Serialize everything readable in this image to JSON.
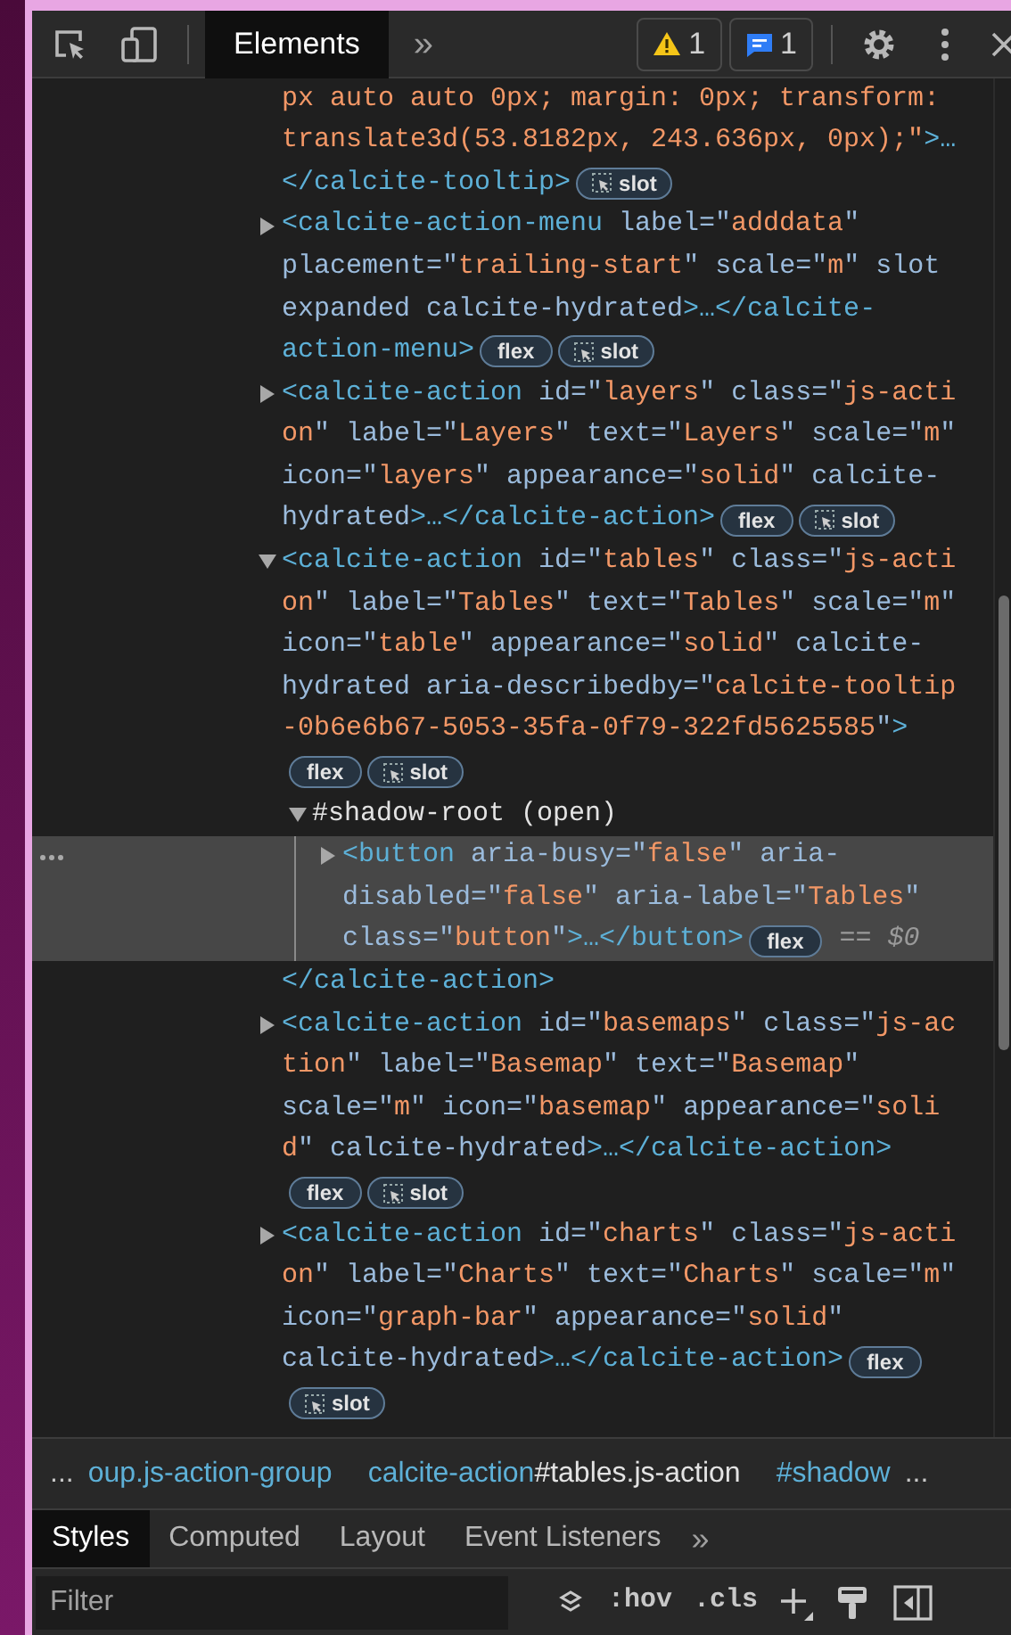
{
  "toolbar": {
    "tabs": [
      {
        "label": "Elements",
        "selected": true
      }
    ],
    "more_tabs": "»",
    "warnings": "1",
    "messages": "1"
  },
  "tree": [
    {
      "kind": "continued",
      "selected": false,
      "lines": [
        {
          "segments": [
            {
              "kind": "val",
              "text": "px auto auto 0px; margin: 0px; transform:"
            }
          ]
        },
        {
          "segments": [
            {
              "kind": "val",
              "text": "translate3d(53.8182px, 243.636px, 0px);\""
            },
            {
              "kind": "tag",
              "text": ">…"
            }
          ]
        },
        {
          "segments": [
            {
              "kind": "tag",
              "text": "</calcite-tooltip>"
            }
          ],
          "badges": [
            {
              "kind": "slot",
              "label": "slot"
            }
          ]
        }
      ]
    },
    {
      "kind": "element",
      "expanded": false,
      "selected": false,
      "lines": [
        {
          "segments": [
            {
              "kind": "tag",
              "text": "<calcite-action-menu"
            },
            {
              "kind": "attr",
              "text": " label=\""
            },
            {
              "kind": "val",
              "text": "adddata"
            },
            {
              "kind": "attr",
              "text": "\""
            }
          ]
        },
        {
          "segments": [
            {
              "kind": "attr",
              "text": "placement=\""
            },
            {
              "kind": "val",
              "text": "trailing-start"
            },
            {
              "kind": "attr",
              "text": "\" scale=\""
            },
            {
              "kind": "val",
              "text": "m"
            },
            {
              "kind": "attr",
              "text": "\" slot"
            }
          ]
        },
        {
          "segments": [
            {
              "kind": "attr",
              "text": "expanded calcite-hydrated"
            },
            {
              "kind": "tag",
              "text": ">…</calcite-"
            }
          ]
        },
        {
          "segments": [
            {
              "kind": "tag",
              "text": "action-menu>"
            }
          ],
          "badges": [
            {
              "kind": "flex",
              "label": "flex"
            },
            {
              "kind": "slot",
              "label": "slot"
            }
          ]
        }
      ]
    },
    {
      "kind": "element",
      "expanded": false,
      "selected": false,
      "lines": [
        {
          "segments": [
            {
              "kind": "tag",
              "text": "<calcite-action"
            },
            {
              "kind": "attr",
              "text": " id=\""
            },
            {
              "kind": "val",
              "text": "layers"
            },
            {
              "kind": "attr",
              "text": "\" class=\""
            },
            {
              "kind": "val",
              "text": "js-acti"
            }
          ]
        },
        {
          "segments": [
            {
              "kind": "val",
              "text": "on"
            },
            {
              "kind": "attr",
              "text": "\" label=\""
            },
            {
              "kind": "val",
              "text": "Layers"
            },
            {
              "kind": "attr",
              "text": "\" text=\""
            },
            {
              "kind": "val",
              "text": "Layers"
            },
            {
              "kind": "attr",
              "text": "\" scale=\""
            },
            {
              "kind": "val",
              "text": "m"
            },
            {
              "kind": "attr",
              "text": "\""
            }
          ]
        },
        {
          "segments": [
            {
              "kind": "attr",
              "text": "icon=\""
            },
            {
              "kind": "val",
              "text": "layers"
            },
            {
              "kind": "attr",
              "text": "\" appearance=\""
            },
            {
              "kind": "val",
              "text": "solid"
            },
            {
              "kind": "attr",
              "text": "\" calcite-"
            }
          ]
        },
        {
          "segments": [
            {
              "kind": "attr",
              "text": "hydrated"
            },
            {
              "kind": "tag",
              "text": ">…</calcite-action>"
            }
          ],
          "badges": [
            {
              "kind": "flex",
              "label": "flex"
            },
            {
              "kind": "slot",
              "label": "slot"
            }
          ]
        }
      ]
    },
    {
      "kind": "element",
      "expanded": true,
      "selected": false,
      "lines": [
        {
          "segments": [
            {
              "kind": "tag",
              "text": "<calcite-action"
            },
            {
              "kind": "attr",
              "text": " id=\""
            },
            {
              "kind": "val",
              "text": "tables"
            },
            {
              "kind": "attr",
              "text": "\" class=\""
            },
            {
              "kind": "val",
              "text": "js-acti"
            }
          ]
        },
        {
          "segments": [
            {
              "kind": "val",
              "text": "on"
            },
            {
              "kind": "attr",
              "text": "\" label=\""
            },
            {
              "kind": "val",
              "text": "Tables"
            },
            {
              "kind": "attr",
              "text": "\" text=\""
            },
            {
              "kind": "val",
              "text": "Tables"
            },
            {
              "kind": "attr",
              "text": "\" scale=\""
            },
            {
              "kind": "val",
              "text": "m"
            },
            {
              "kind": "attr",
              "text": "\""
            }
          ]
        },
        {
          "segments": [
            {
              "kind": "attr",
              "text": "icon=\""
            },
            {
              "kind": "val",
              "text": "table"
            },
            {
              "kind": "attr",
              "text": "\" appearance=\""
            },
            {
              "kind": "val",
              "text": "solid"
            },
            {
              "kind": "attr",
              "text": "\" calcite-"
            }
          ]
        },
        {
          "segments": [
            {
              "kind": "attr",
              "text": "hydrated aria-describedby=\""
            },
            {
              "kind": "val",
              "text": "calcite-tooltip"
            }
          ]
        },
        {
          "segments": [
            {
              "kind": "val",
              "text": "-0b6e6b67-5053-35fa-0f79-322fd5625585"
            },
            {
              "kind": "attr",
              "text": "\""
            },
            {
              "kind": "tag",
              "text": ">"
            }
          ]
        },
        {
          "badges": [
            {
              "kind": "flex",
              "label": "flex"
            },
            {
              "kind": "slot",
              "label": "slot"
            }
          ]
        }
      ],
      "children": [
        {
          "kind": "shadow-root",
          "expanded": true,
          "selected": false,
          "lines": [
            {
              "segments": [
                {
                  "kind": "text",
                  "text": "#shadow-root (open)"
                }
              ]
            }
          ],
          "children": [
            {
              "kind": "element",
              "expanded": false,
              "selected": true,
              "ref": "== $0",
              "lines": [
                {
                  "segments": [
                    {
                      "kind": "tag",
                      "text": "<button"
                    },
                    {
                      "kind": "attr",
                      "text": " aria-busy=\""
                    },
                    {
                      "kind": "val",
                      "text": "false"
                    },
                    {
                      "kind": "attr",
                      "text": "\" aria-"
                    }
                  ]
                },
                {
                  "segments": [
                    {
                      "kind": "attr",
                      "text": "disabled=\""
                    },
                    {
                      "kind": "val",
                      "text": "false"
                    },
                    {
                      "kind": "attr",
                      "text": "\" aria-label=\""
                    },
                    {
                      "kind": "val",
                      "text": "Tables"
                    },
                    {
                      "kind": "attr",
                      "text": "\""
                    }
                  ]
                },
                {
                  "segments": [
                    {
                      "kind": "attr",
                      "text": "class=\""
                    },
                    {
                      "kind": "val",
                      "text": "button"
                    },
                    {
                      "kind": "attr",
                      "text": "\""
                    },
                    {
                      "kind": "tag",
                      "text": ">…</button>"
                    }
                  ],
                  "badges": [
                    {
                      "kind": "flex",
                      "label": "flex"
                    }
                  ]
                }
              ]
            }
          ]
        }
      ],
      "closing": "</calcite-action>"
    },
    {
      "kind": "element",
      "expanded": false,
      "selected": false,
      "lines": [
        {
          "segments": [
            {
              "kind": "tag",
              "text": "<calcite-action"
            },
            {
              "kind": "attr",
              "text": " id=\""
            },
            {
              "kind": "val",
              "text": "basemaps"
            },
            {
              "kind": "attr",
              "text": "\" class=\""
            },
            {
              "kind": "val",
              "text": "js-ac"
            }
          ]
        },
        {
          "segments": [
            {
              "kind": "val",
              "text": "tion"
            },
            {
              "kind": "attr",
              "text": "\" label=\""
            },
            {
              "kind": "val",
              "text": "Basemap"
            },
            {
              "kind": "attr",
              "text": "\" text=\""
            },
            {
              "kind": "val",
              "text": "Basemap"
            },
            {
              "kind": "attr",
              "text": "\""
            }
          ]
        },
        {
          "segments": [
            {
              "kind": "attr",
              "text": "scale=\""
            },
            {
              "kind": "val",
              "text": "m"
            },
            {
              "kind": "attr",
              "text": "\" icon=\""
            },
            {
              "kind": "val",
              "text": "basemap"
            },
            {
              "kind": "attr",
              "text": "\" appearance=\""
            },
            {
              "kind": "val",
              "text": "soli"
            }
          ]
        },
        {
          "segments": [
            {
              "kind": "val",
              "text": "d"
            },
            {
              "kind": "attr",
              "text": "\" calcite-hydrated"
            },
            {
              "kind": "tag",
              "text": ">…</calcite-action>"
            }
          ]
        },
        {
          "badges": [
            {
              "kind": "flex",
              "label": "flex"
            },
            {
              "kind": "slot",
              "label": "slot"
            }
          ]
        }
      ]
    },
    {
      "kind": "element",
      "expanded": false,
      "selected": false,
      "lines": [
        {
          "segments": [
            {
              "kind": "tag",
              "text": "<calcite-action"
            },
            {
              "kind": "attr",
              "text": " id=\""
            },
            {
              "kind": "val",
              "text": "charts"
            },
            {
              "kind": "attr",
              "text": "\" class=\""
            },
            {
              "kind": "val",
              "text": "js-acti"
            }
          ]
        },
        {
          "segments": [
            {
              "kind": "val",
              "text": "on"
            },
            {
              "kind": "attr",
              "text": "\" label=\""
            },
            {
              "kind": "val",
              "text": "Charts"
            },
            {
              "kind": "attr",
              "text": "\" text=\""
            },
            {
              "kind": "val",
              "text": "Charts"
            },
            {
              "kind": "attr",
              "text": "\" scale=\""
            },
            {
              "kind": "val",
              "text": "m"
            },
            {
              "kind": "attr",
              "text": "\""
            }
          ]
        },
        {
          "segments": [
            {
              "kind": "attr",
              "text": "icon=\""
            },
            {
              "kind": "val",
              "text": "graph-bar"
            },
            {
              "kind": "attr",
              "text": "\" appearance=\""
            },
            {
              "kind": "val",
              "text": "solid"
            },
            {
              "kind": "attr",
              "text": "\""
            }
          ]
        },
        {
          "segments": [
            {
              "kind": "attr",
              "text": "calcite-hydrated"
            },
            {
              "kind": "tag",
              "text": ">…</calcite-action>"
            }
          ],
          "badges": [
            {
              "kind": "flex",
              "label": "flex"
            }
          ]
        },
        {
          "badges": [
            {
              "kind": "slot",
              "label": "slot"
            }
          ]
        }
      ]
    }
  ],
  "breadcrumbs": {
    "overflow_left": "...",
    "overflow_right": "...",
    "items": [
      {
        "parts": [
          {
            "kind": "tag",
            "text": "oup.js-action-group"
          }
        ]
      },
      {
        "parts": [
          {
            "kind": "tag",
            "text": "calcite-action"
          },
          {
            "kind": "text",
            "text": "#tables.js-action"
          }
        ]
      },
      {
        "parts": [
          {
            "kind": "tag",
            "text": "#shadow"
          }
        ]
      }
    ]
  },
  "sidebar_tabs": [
    {
      "label": "Styles",
      "selected": true
    },
    {
      "label": "Computed",
      "selected": false
    },
    {
      "label": "Layout",
      "selected": false
    },
    {
      "label": "Event Listeners",
      "selected": false
    }
  ],
  "sidebar_more": "»",
  "styles_toolbar": {
    "placeholder": "Filter",
    "hov": ":hov",
    "cls": ".cls"
  }
}
